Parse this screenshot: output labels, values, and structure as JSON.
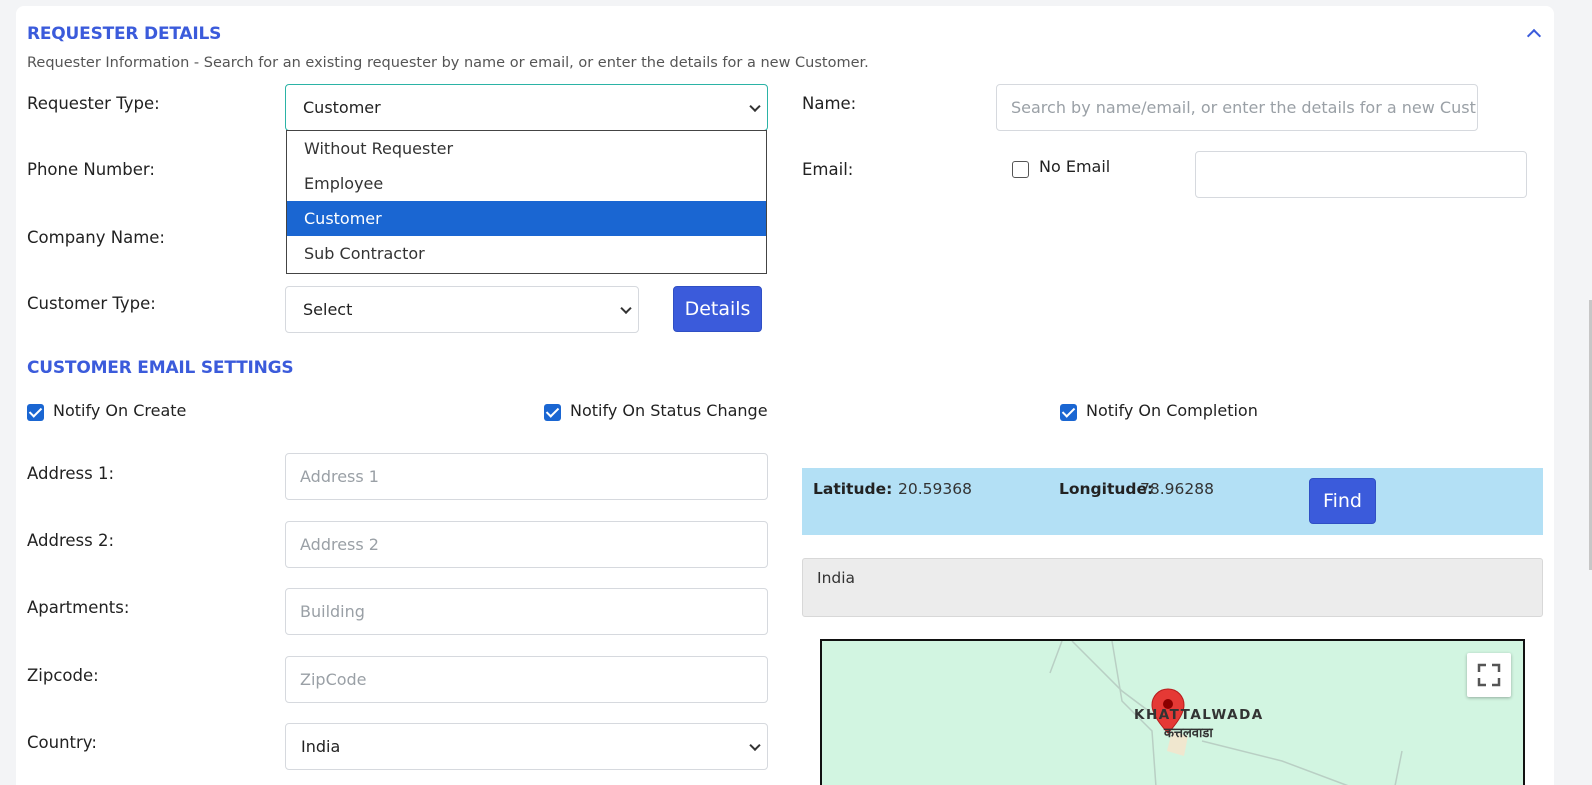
{
  "requester": {
    "title": "REQUESTER DETAILS",
    "description": "Requester Information - Search for an existing requester by name or email, or enter the details for a new Customer.",
    "requester_type_label": "Requester Type:",
    "requester_type_value": "Customer",
    "requester_type_options": [
      "Without Requester",
      "Employee",
      "Customer",
      "Sub Contractor"
    ],
    "name_label": "Name:",
    "name_placeholder": "Search by name/email, or enter the details for a new Cust",
    "phone_label": "Phone Number:",
    "email_label": "Email:",
    "no_email_label": "No Email",
    "company_label": "Company Name:",
    "customer_type_label": "Customer Type:",
    "customer_type_value": "Select",
    "details_button": "Details"
  },
  "email_settings": {
    "title": "CUSTOMER EMAIL SETTINGS",
    "notify_on_create": "Notify On Create",
    "notify_on_status_change": "Notify On Status Change",
    "notify_on_completion": "Notify On Completion"
  },
  "address": {
    "address1_label": "Address 1:",
    "address1_placeholder": "Address 1",
    "address2_label": "Address 2:",
    "address2_placeholder": "Address 2",
    "apartments_label": "Apartments:",
    "apartments_placeholder": "Building",
    "zipcode_label": "Zipcode:",
    "zipcode_placeholder": "ZipCode",
    "country_label": "Country:",
    "country_value": "India"
  },
  "location": {
    "latitude_label": "Latitude:",
    "latitude_value": "20.59368",
    "longitude_label": "Longitude:",
    "longitude_value": "78.96288",
    "find_button": "Find",
    "address_display": "India",
    "map_place_latin": "KHATTALWADA",
    "map_place_devanagari": "कत्तलवाडा"
  },
  "colors": {
    "accent": "#3b5bdb",
    "selected": "#1a66d2",
    "coords_bg": "#b3e0f5",
    "map_bg": "#d2f5e1",
    "marker": "#e53935"
  }
}
